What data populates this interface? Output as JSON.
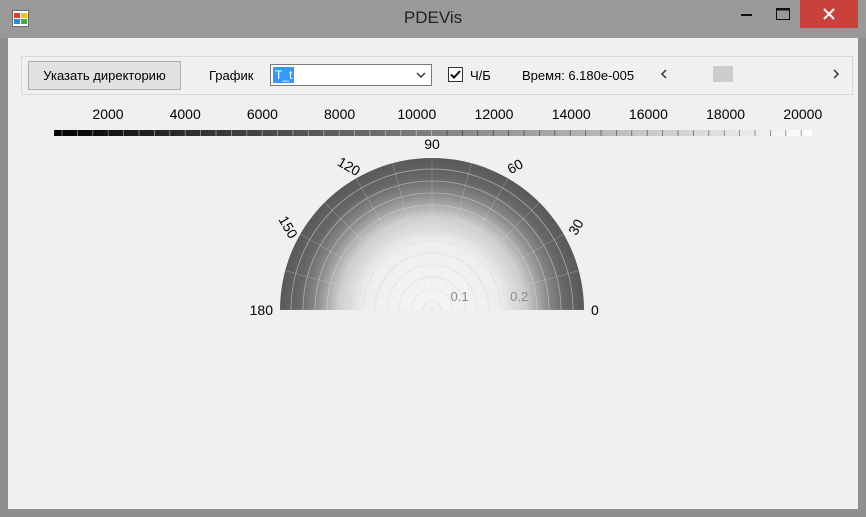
{
  "window": {
    "title": "PDEVis",
    "icons": {
      "app": "app-window-icon",
      "minimize": "minimize-icon",
      "maximize": "maximize-icon",
      "close": "close-icon"
    }
  },
  "toolbar": {
    "directory_button": "Указать директорию",
    "graph_label": "График",
    "graph_value": "T_t",
    "bw_label": "Ч/Б",
    "bw_checked": true,
    "time_label": "Время: 6.180e-005",
    "scroll_fraction": 0.3
  },
  "colorbar": {
    "ticks": [
      "2000",
      "4000",
      "6000",
      "8000",
      "10000",
      "12000",
      "14000",
      "16000",
      "18000",
      "20000"
    ]
  },
  "polar": {
    "angle_labels": [
      "0",
      "30",
      "60",
      "90",
      "120",
      "150",
      "180"
    ],
    "radius_labels": [
      "0.1",
      "0.2"
    ]
  }
}
